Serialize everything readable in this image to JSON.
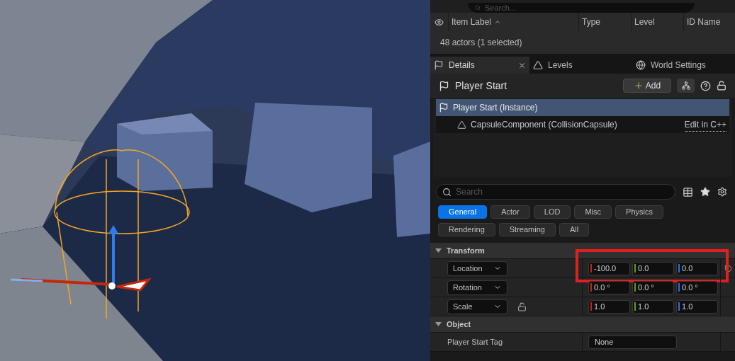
{
  "outliner": {
    "search": {
      "placeholder": "Search..."
    },
    "columns": [
      {
        "label": "Item Label",
        "sorted": true
      },
      {
        "label": "Type",
        "sorted": false
      },
      {
        "label": "Level",
        "sorted": false
      },
      {
        "label": "ID Name",
        "sorted": false
      }
    ],
    "status": "48 actors (1 selected)"
  },
  "tabs": [
    {
      "label": "Details",
      "selected": true,
      "closable": true,
      "kind": "details"
    },
    {
      "label": "Levels",
      "selected": false,
      "closable": false,
      "kind": "levels"
    },
    {
      "label": "World Settings",
      "selected": false,
      "closable": false,
      "kind": "world"
    }
  ],
  "details": {
    "title": "Player Start",
    "add_button": "Add",
    "components": [
      {
        "label": "Player Start (Instance)",
        "selected": true,
        "kind": "actor"
      },
      {
        "label": "CapsuleComponent (CollisionCapsule)",
        "selected": false,
        "kind": "component",
        "link": "Edit in C++"
      }
    ],
    "search": {
      "placeholder": "Search"
    },
    "filters": [
      {
        "label": "General",
        "selected": true
      },
      {
        "label": "Actor",
        "selected": false
      },
      {
        "label": "LOD",
        "selected": false
      },
      {
        "label": "Misc",
        "selected": false
      },
      {
        "label": "Physics",
        "selected": false
      },
      {
        "label": "Rendering",
        "selected": false
      },
      {
        "label": "Streaming",
        "selected": false
      },
      {
        "label": "All",
        "selected": false
      }
    ],
    "sections": [
      {
        "title": "Transform",
        "expanded": true,
        "rows": [
          {
            "kind": "vector",
            "label": "Location",
            "highlighted": true,
            "lock": false,
            "reset": true,
            "values": [
              {
                "text": "-100.0",
                "color": "#c3270e"
              },
              {
                "text": "0.0",
                "color": "#5a9e14"
              },
              {
                "text": "0.0",
                "color": "#2a74e0"
              }
            ]
          },
          {
            "kind": "vector",
            "label": "Rotation",
            "highlighted": false,
            "lock": false,
            "reset": false,
            "values": [
              {
                "text": "0.0 °",
                "color": "#c3270e"
              },
              {
                "text": "0.0 °",
                "color": "#5a9e14"
              },
              {
                "text": "0.0 °",
                "color": "#2a74e0"
              }
            ]
          },
          {
            "kind": "vector",
            "label": "Scale",
            "highlighted": false,
            "lock": true,
            "reset": false,
            "values": [
              {
                "text": "1.0",
                "color": "#c3270e"
              },
              {
                "text": "1.0",
                "color": "#5a9e14"
              },
              {
                "text": "1.0",
                "color": "#2a74e0"
              }
            ]
          }
        ]
      },
      {
        "title": "Object",
        "expanded": true,
        "rows": [
          {
            "kind": "text",
            "label": "Player Start Tag",
            "value": "None"
          }
        ]
      }
    ]
  }
}
